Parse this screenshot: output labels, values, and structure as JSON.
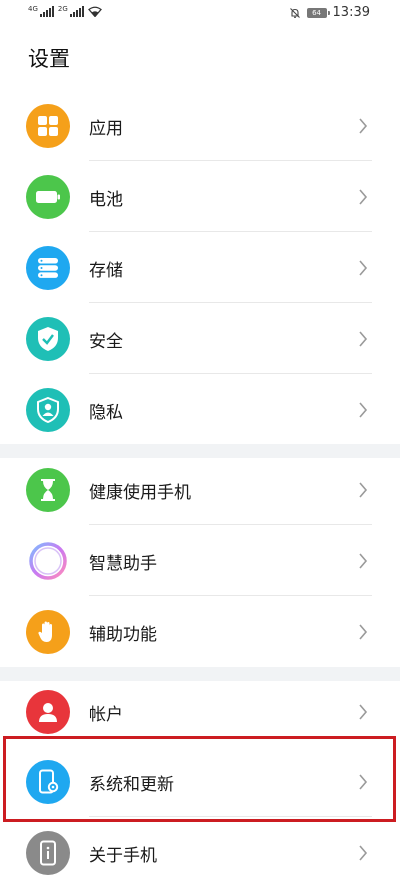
{
  "status_bar": {
    "network_1": "4G",
    "network_2": "2G",
    "battery": "64",
    "time": "13:39"
  },
  "page": {
    "title": "设置"
  },
  "settings": [
    {
      "label": "应用",
      "icon": "apps-grid-icon",
      "color": "#F5A01A"
    },
    {
      "label": "电池",
      "icon": "battery-icon",
      "color": "#4CC64B"
    },
    {
      "label": "存储",
      "icon": "storage-icon",
      "color": "#1FA8F0"
    },
    {
      "label": "安全",
      "icon": "security-shield-icon",
      "color": "#1FBFB6"
    },
    {
      "label": "隐私",
      "icon": "privacy-shield-icon",
      "color": "#1FBFB6"
    },
    {
      "label": "健康使用手机",
      "icon": "hourglass-icon",
      "color": "#4CC64B"
    },
    {
      "label": "智慧助手",
      "icon": "smart-assistant-icon",
      "color": "#B56BE8"
    },
    {
      "label": "辅助功能",
      "icon": "hand-icon",
      "color": "#F5A01A"
    },
    {
      "label": "帐户",
      "icon": "account-icon",
      "color": "#E8353B"
    },
    {
      "label": "系统和更新",
      "icon": "phone-settings-icon",
      "color": "#1FA8F0"
    },
    {
      "label": "关于手机",
      "icon": "phone-info-icon",
      "color": "#8A8A8A"
    }
  ],
  "highlight_color": "#CC1C21"
}
